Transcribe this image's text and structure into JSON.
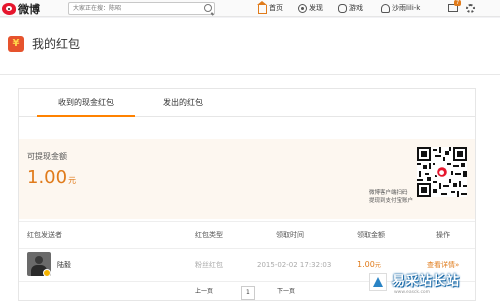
{
  "topbar": {
    "logo_text": "微博",
    "search_placeholder": "大家正在搜：陈昭",
    "nav": [
      {
        "label": "首页",
        "icon": "home-icon"
      },
      {
        "label": "发现",
        "icon": "discover-icon"
      },
      {
        "label": "游戏",
        "icon": "game-icon"
      },
      {
        "label": "沙雨lili-k",
        "icon": "user-icon"
      }
    ],
    "badge": "7"
  },
  "page": {
    "title": "我的红包",
    "icon_glyph": "¥"
  },
  "tabs": [
    "收到的现金红包",
    "发出的红包"
  ],
  "balance": {
    "label": "可提现金额",
    "amount": "1.00",
    "unit": "元",
    "qr_hint_line1": "微博客户端扫码",
    "qr_hint_line2": "提现到支付宝账户"
  },
  "table": {
    "headers": [
      "红包发送者",
      "红包类型",
      "领取时间",
      "领取金额",
      "操作"
    ],
    "rows": [
      {
        "sender": "陆毅",
        "type": "粉丝红包",
        "time": "2015-02-02 17:32:03",
        "amount": "1.00",
        "unit": "元",
        "action": "查看详情»"
      }
    ]
  },
  "pager": {
    "prev": "上一页",
    "current": "1",
    "next": "下一页"
  },
  "watermark": {
    "text": "易采站长站",
    "url": "www.easck.com"
  },
  "colors": {
    "accent": "#e07b1b",
    "brand_red": "#e6162d",
    "balance_bg": "#fdf7f0"
  }
}
